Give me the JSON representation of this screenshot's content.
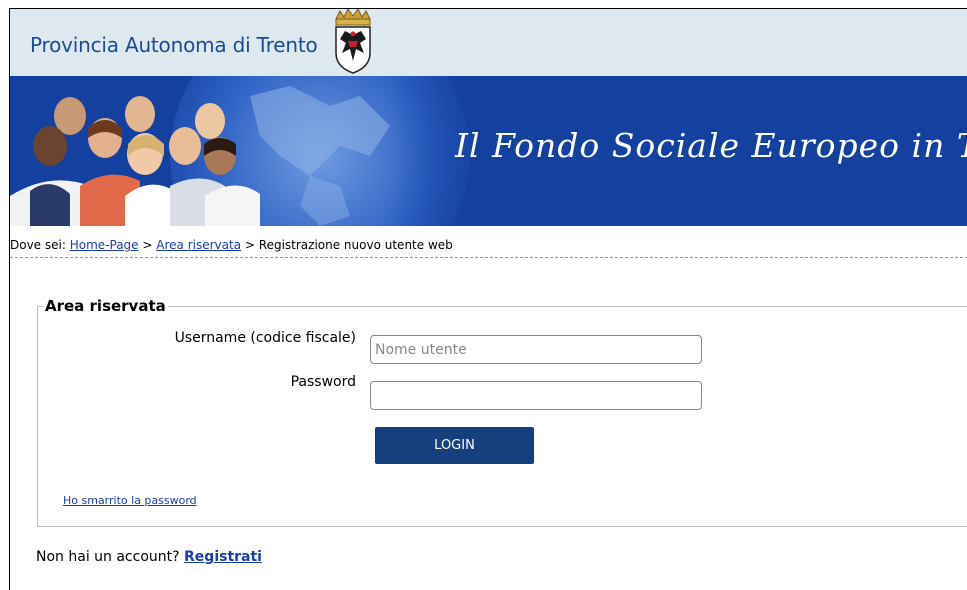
{
  "header": {
    "site_name": "Provincia Autonoma di Trento",
    "banner_title": "Il Fondo Sociale Europeo in Trentino"
  },
  "breadcrumb": {
    "prefix": "Dove sei:",
    "sep1": ">",
    "home": "Home-Page",
    "sep2": ">",
    "area": "Area riservata",
    "sep3": ">",
    "current": "Registrazione nuovo utente web"
  },
  "login": {
    "legend": "Area riservata",
    "username_label": "Username (codice fiscale)",
    "username_placeholder": "Nome utente",
    "username_value": "",
    "password_label": "Password",
    "password_value": "",
    "login_button": "LOGIN",
    "lost_password": "Ho smarrito la password"
  },
  "register": {
    "prompt": "Non hai un account?",
    "link": "Registrati"
  },
  "colors": {
    "topbar": "#dde9ef",
    "banner": "#1440a0",
    "button": "#163f7e",
    "link": "#1a3ea8"
  }
}
